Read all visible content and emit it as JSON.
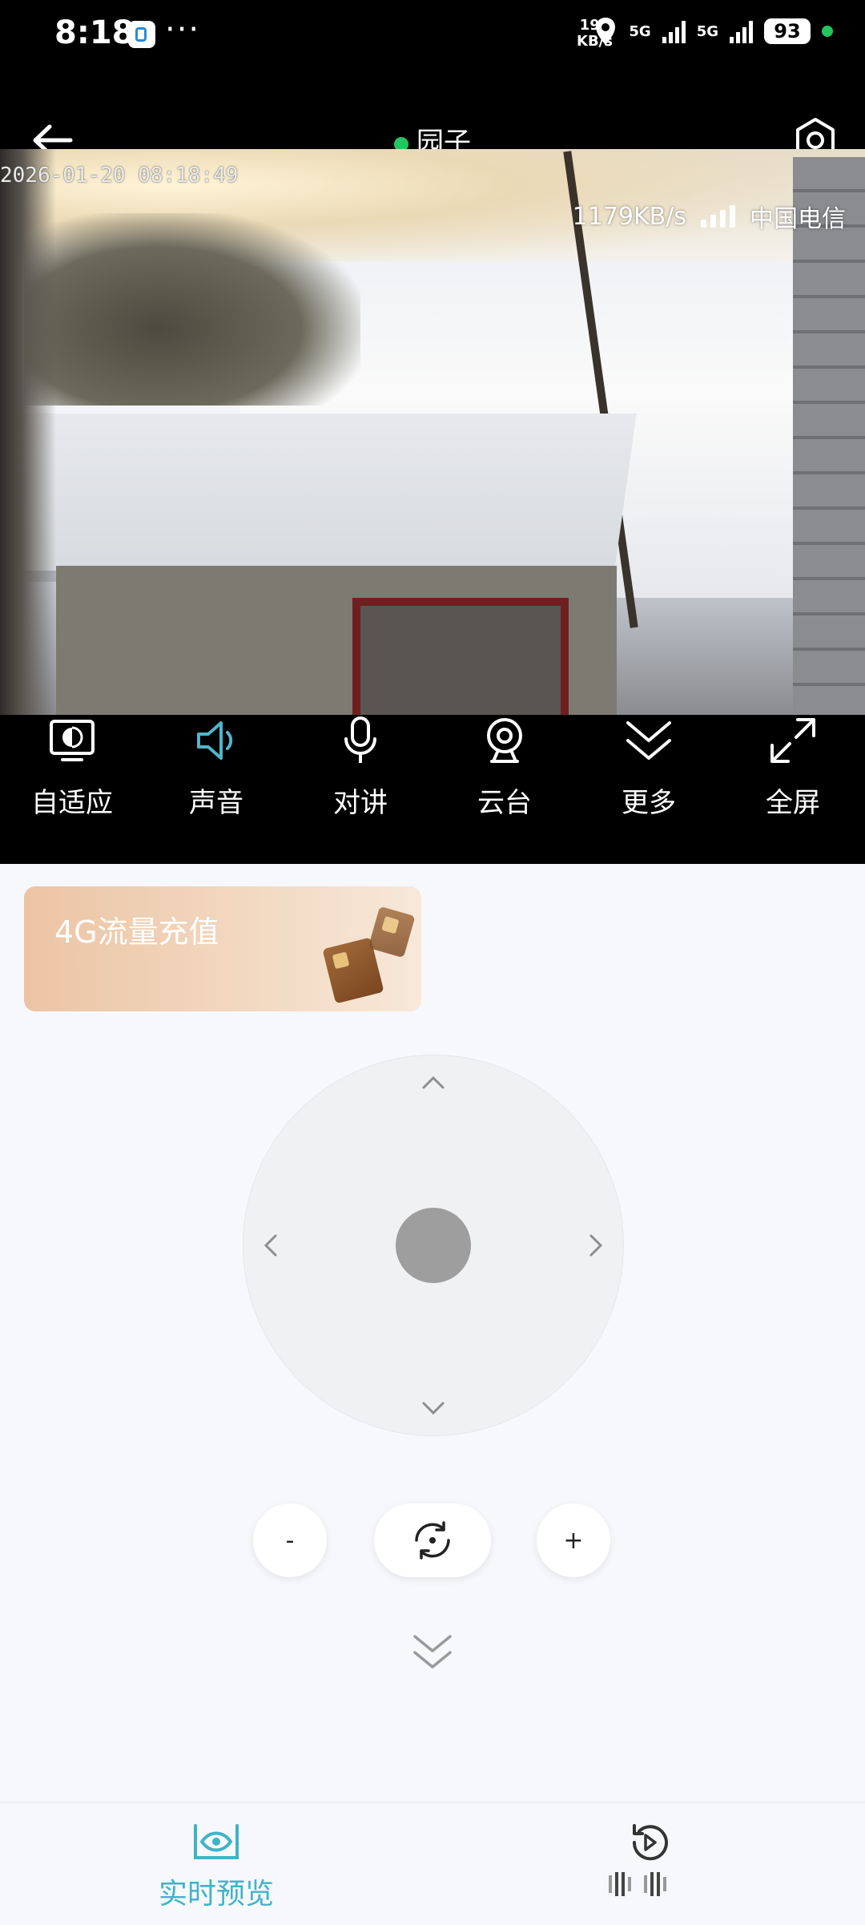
{
  "status_bar": {
    "time": "8:18",
    "more": "···",
    "speed_value": "193",
    "speed_unit": "KB/s",
    "net1": "5G",
    "net2": "5G",
    "battery": "93"
  },
  "header": {
    "title": "园子",
    "online_color": "#22c55e"
  },
  "video": {
    "timestamp": "2026-01-20 08:18:49",
    "bitrate": "1179KB/s",
    "carrier": "中国电信"
  },
  "controls": [
    {
      "label": "自适应",
      "icon": "adaptive-screen-icon"
    },
    {
      "label": "声音",
      "icon": "speaker-icon",
      "active": true
    },
    {
      "label": "对讲",
      "icon": "microphone-icon"
    },
    {
      "label": "云台",
      "icon": "camera-ptz-icon"
    },
    {
      "label": "更多",
      "icon": "chevron-down-icon"
    },
    {
      "label": "全屏",
      "icon": "fullscreen-icon"
    }
  ],
  "promo": {
    "text": "4G流量充值"
  },
  "zoom": {
    "minus": "-",
    "plus": "+"
  },
  "bottom_nav": {
    "live": "实时预览",
    "accent_color": "#3fb3c9"
  }
}
